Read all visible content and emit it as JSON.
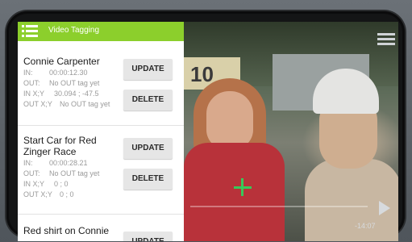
{
  "app": {
    "title": "Video Tagging"
  },
  "labels": {
    "in": "IN:",
    "out": "OUT:",
    "in_xy": "IN X;Y",
    "out_xy": "OUT X;Y"
  },
  "buttons": {
    "update": "UPDATE",
    "delete": "DELETE"
  },
  "tags": [
    {
      "name": "Connie Carpenter",
      "in": "00:00:12.30",
      "out": "No OUT tag yet",
      "in_xy": "30.094 ; -47.5",
      "out_xy": "No OUT tag yet"
    },
    {
      "name": "Start Car for Red Zinger Race",
      "in": "00:00:28.21",
      "out": "No OUT tag yet",
      "in_xy": "0 ; 0",
      "out_xy": "0 ; 0"
    },
    {
      "name": "Red shirt on Connie"
    }
  ],
  "video": {
    "remaining_time": "-14:07",
    "sign_text": "10"
  },
  "colors": {
    "header": "#8ccf2c",
    "crosshair": "#38c85a"
  }
}
